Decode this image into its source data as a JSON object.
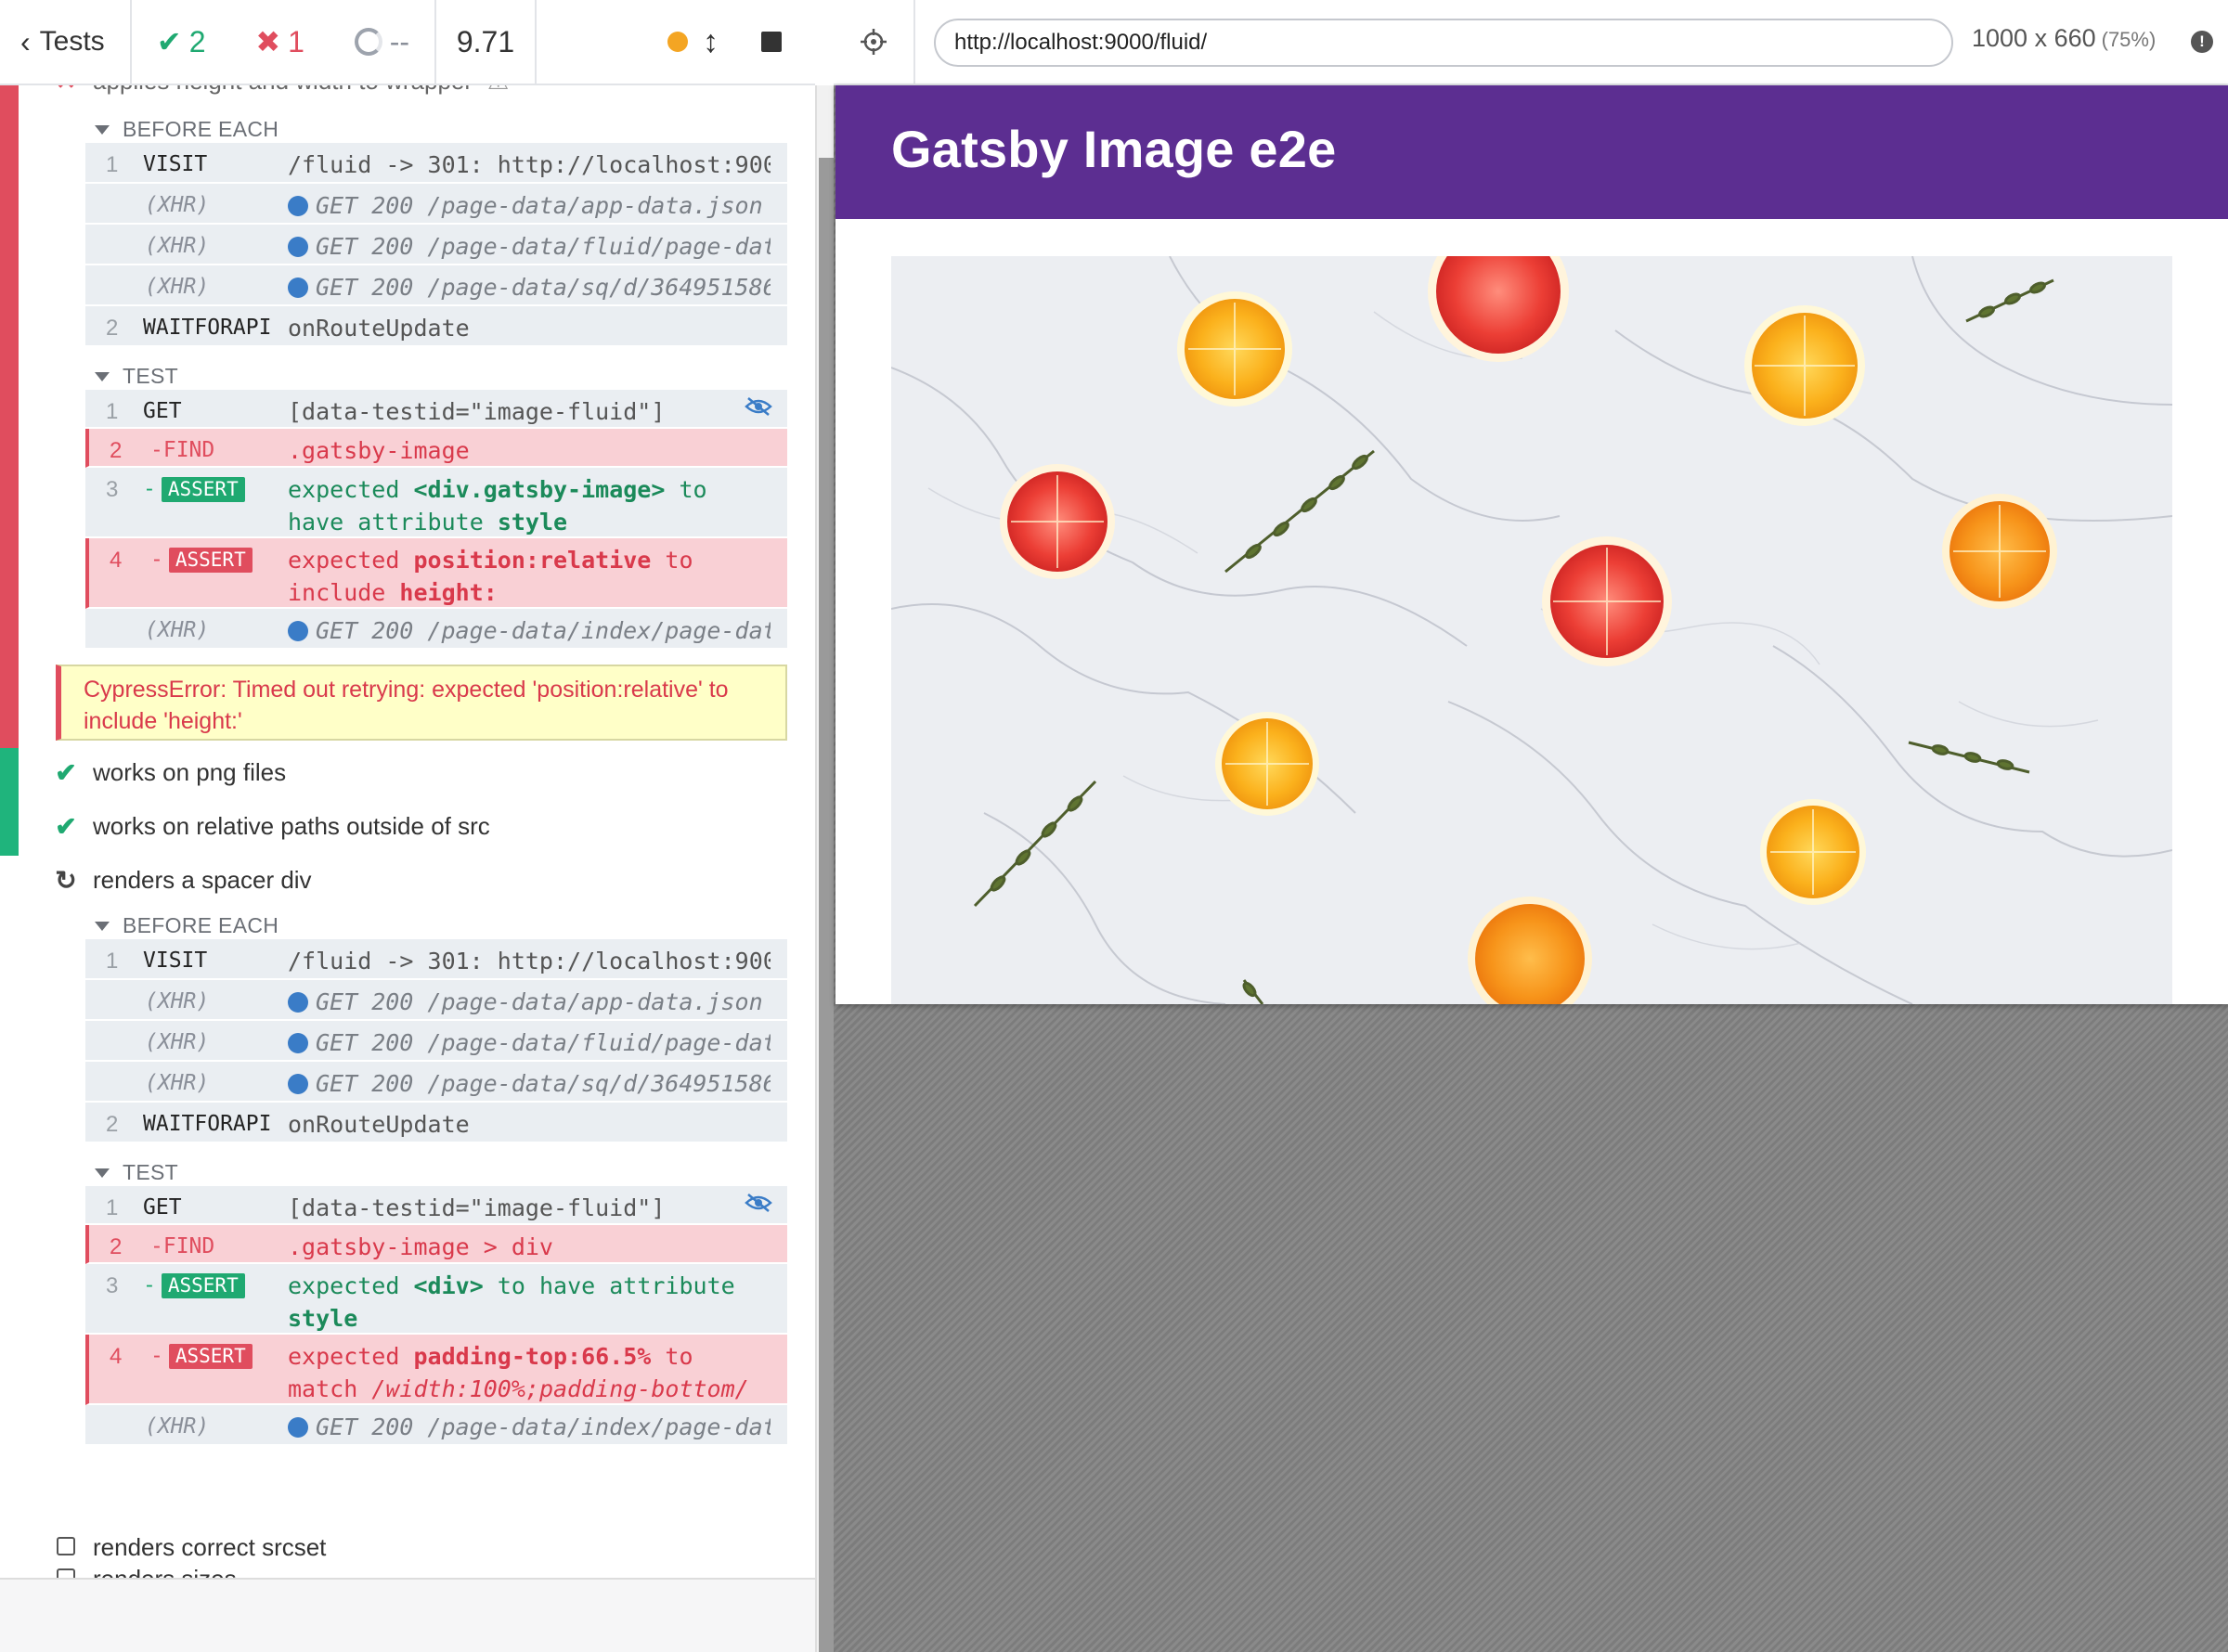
{
  "reporter": {
    "header": {
      "tests_label": "Tests",
      "passed": "2",
      "failed": "1",
      "pending": "--",
      "duration": "9.71"
    },
    "partial_test_title": "applies height and width to wrapper",
    "tests": [
      {
        "state": "failed",
        "hooks": [
          {
            "name": "BEFORE EACH",
            "commands": [
              {
                "num": "1",
                "name": "VISIT",
                "message": "/fluid -> 301: http://localhost:900…"
              },
              {
                "num": "",
                "name": "(XHR)",
                "message": "GET 200 /page-data/app-data.json"
              },
              {
                "num": "",
                "name": "(XHR)",
                "message": "GET 200 /page-data/fluid/page-dat…"
              },
              {
                "num": "",
                "name": "(XHR)",
                "message": "GET 200 /page-data/sq/d/364951586…"
              },
              {
                "num": "2",
                "name": "WAITFORAPI",
                "message": "onRouteUpdate"
              }
            ]
          },
          {
            "name": "TEST",
            "commands": [
              {
                "num": "1",
                "name": "GET",
                "message": "[data-testid=\"image-fluid\"]"
              },
              {
                "num": "2",
                "name": "-FIND",
                "message": ".gatsby-image"
              },
              {
                "num": "3",
                "name": "ASSERT",
                "message_parts": [
                  "expected",
                  "<div.gatsby-image>",
                  "to have",
                  "attribute",
                  "style"
                ]
              },
              {
                "num": "4",
                "name": "ASSERT",
                "message_parts": [
                  "expected",
                  "position:relative",
                  "to",
                  "include",
                  "height:"
                ]
              },
              {
                "num": "",
                "name": "(XHR)",
                "message": "GET 200 /page-data/index/page-dat…"
              }
            ]
          }
        ],
        "error": "CypressError: Timed out retrying: expected 'position:relative' to include 'height:'"
      },
      {
        "state": "passed",
        "title": "works on png files"
      },
      {
        "state": "passed",
        "title": "works on relative paths outside of src"
      },
      {
        "state": "running",
        "title": "renders a spacer div",
        "hooks": [
          {
            "name": "BEFORE EACH",
            "commands": [
              {
                "num": "1",
                "name": "VISIT",
                "message": "/fluid -> 301: http://localhost:900…"
              },
              {
                "num": "",
                "name": "(XHR)",
                "message": "GET 200 /page-data/app-data.json"
              },
              {
                "num": "",
                "name": "(XHR)",
                "message": "GET 200 /page-data/fluid/page-dat…"
              },
              {
                "num": "",
                "name": "(XHR)",
                "message": "GET 200 /page-data/sq/d/364951586…"
              },
              {
                "num": "2",
                "name": "WAITFORAPI",
                "message": "onRouteUpdate"
              }
            ]
          },
          {
            "name": "TEST",
            "commands": [
              {
                "num": "1",
                "name": "GET",
                "message": "[data-testid=\"image-fluid\"]"
              },
              {
                "num": "2",
                "name": "-FIND",
                "message": ".gatsby-image > div"
              },
              {
                "num": "3",
                "name": "ASSERT",
                "message_parts": [
                  "expected",
                  "<div>",
                  "to have attribute",
                  "style"
                ]
              },
              {
                "num": "4",
                "name": "ASSERT",
                "message_parts": [
                  "expected",
                  "padding-top:66.5%",
                  "to match",
                  "/width:100%;padding-bottom/"
                ]
              },
              {
                "num": "",
                "name": "(XHR)",
                "message": "GET 200 /page-data/index/page-dat…"
              }
            ]
          }
        ]
      },
      {
        "state": "pending",
        "title": "renders sizes"
      },
      {
        "state": "pending",
        "title": "renders correct srcset"
      }
    ]
  },
  "aut": {
    "url": "http://localhost:9000/fluid/",
    "viewport": "1000 x 660",
    "scale": "(75%)",
    "site_title": "Gatsby Image e2e"
  },
  "colors": {
    "pass": "#1fa971",
    "fail": "#e04d5e",
    "site_header": "#5c2e91",
    "xhr_dot": "#3a7cc7"
  },
  "icons": [
    "chevron-left-icon",
    "check-icon",
    "x-icon",
    "pending-ring-icon",
    "status-dot-icon",
    "resize-arrows-icon",
    "stop-icon",
    "crosshair-icon",
    "info-icon",
    "eye-slash-icon",
    "refresh-icon",
    "warning-icon",
    "checkbox-icon",
    "triangle-down-icon"
  ]
}
